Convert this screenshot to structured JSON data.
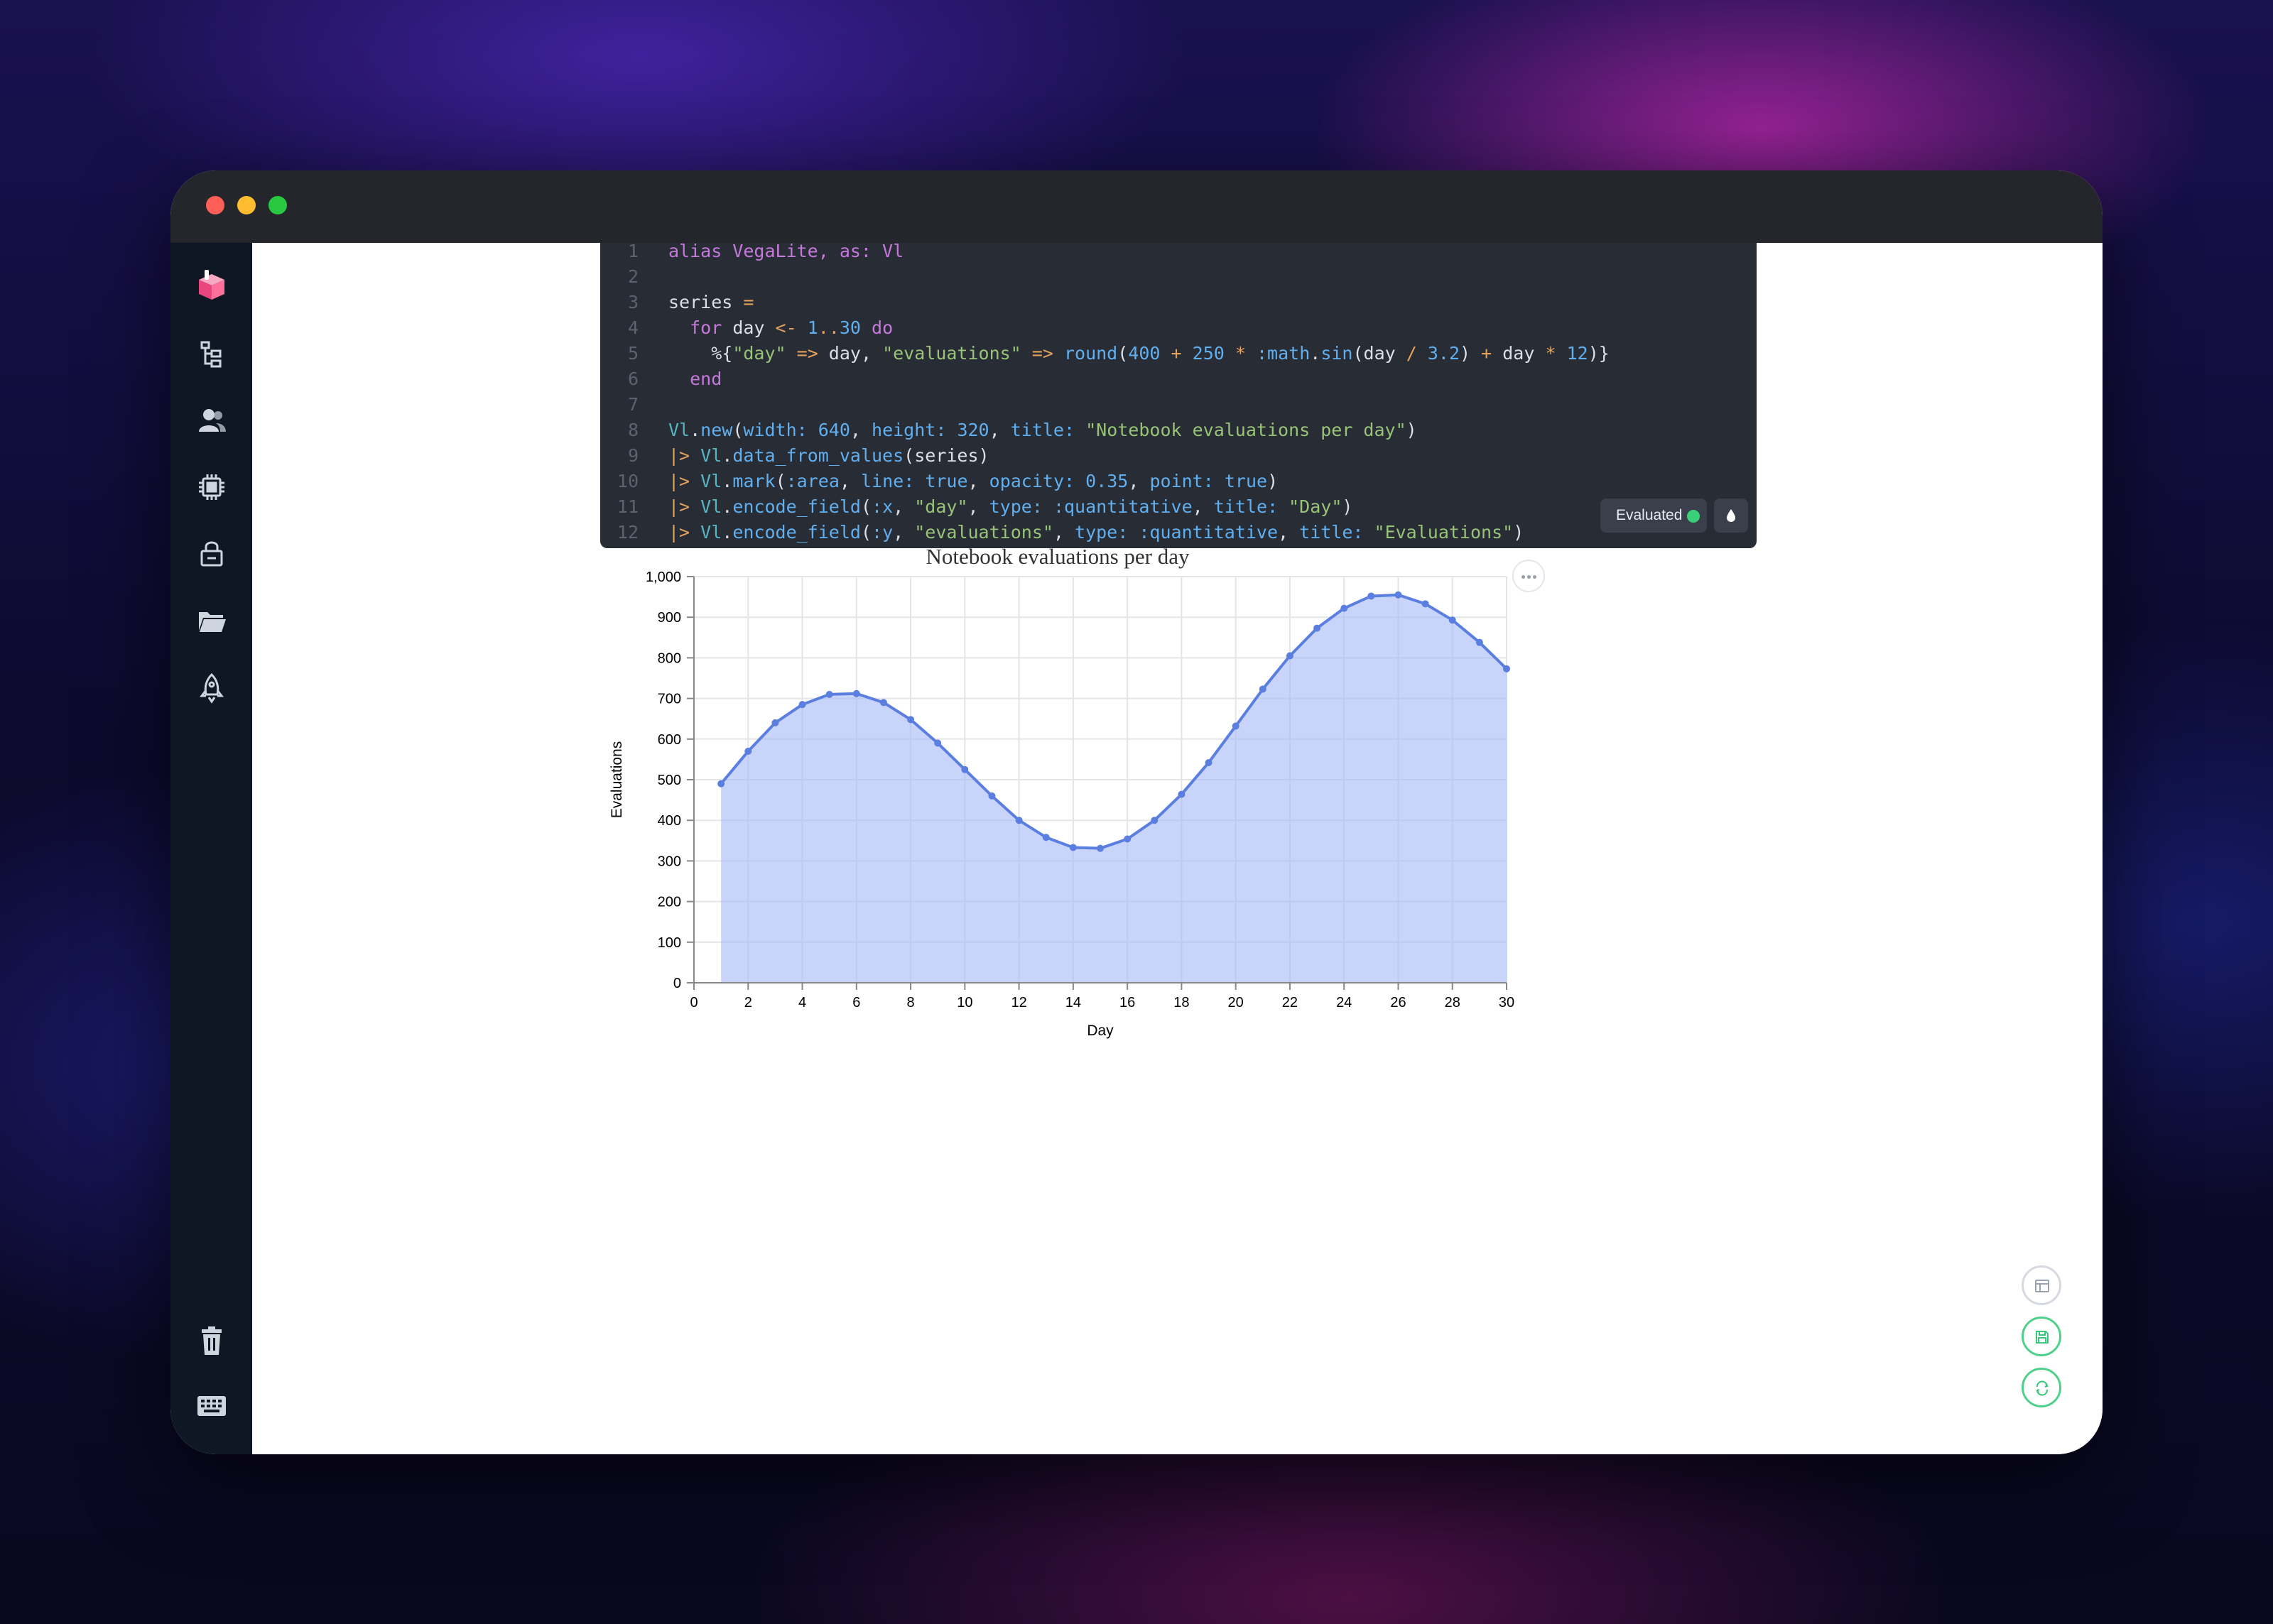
{
  "sidebar": {
    "icons": [
      "livebook-logo-icon",
      "explorer-icon",
      "users-icon",
      "runtime-chip-icon",
      "secrets-lock-icon",
      "files-folder-icon",
      "deploy-rocket-icon",
      "trash-icon",
      "keyboard-icon"
    ],
    "help_label": "?"
  },
  "code_cell": {
    "lines": [
      {
        "n": "1",
        "parts": [
          {
            "t": "alias VegaLite, as: Vl",
            "c": "kw"
          }
        ]
      },
      {
        "n": "2",
        "parts": []
      },
      {
        "n": "3",
        "parts": [
          {
            "t": "series ",
            "c": ""
          },
          {
            "t": "=",
            "c": "op"
          }
        ]
      },
      {
        "n": "4",
        "parts": [
          {
            "t": "  ",
            "c": ""
          },
          {
            "t": "for",
            "c": "kw"
          },
          {
            "t": " day ",
            "c": ""
          },
          {
            "t": "<-",
            "c": "op"
          },
          {
            "t": " ",
            "c": ""
          },
          {
            "t": "1",
            "c": "num"
          },
          {
            "t": "..",
            "c": "op"
          },
          {
            "t": "30",
            "c": "num"
          },
          {
            "t": " ",
            "c": ""
          },
          {
            "t": "do",
            "c": "kw"
          }
        ]
      },
      {
        "n": "5",
        "parts": [
          {
            "t": "    %{",
            "c": ""
          },
          {
            "t": "\"day\"",
            "c": "str"
          },
          {
            "t": " ",
            "c": ""
          },
          {
            "t": "=>",
            "c": "op"
          },
          {
            "t": " day, ",
            "c": ""
          },
          {
            "t": "\"evaluations\"",
            "c": "str"
          },
          {
            "t": " ",
            "c": ""
          },
          {
            "t": "=>",
            "c": "op"
          },
          {
            "t": " ",
            "c": ""
          },
          {
            "t": "round",
            "c": "fn"
          },
          {
            "t": "(",
            "c": ""
          },
          {
            "t": "400",
            "c": "num"
          },
          {
            "t": " ",
            "c": ""
          },
          {
            "t": "+",
            "c": "op"
          },
          {
            "t": " ",
            "c": ""
          },
          {
            "t": "250",
            "c": "num"
          },
          {
            "t": " ",
            "c": ""
          },
          {
            "t": "*",
            "c": "op"
          },
          {
            "t": " ",
            "c": ""
          },
          {
            "t": ":math",
            "c": "key"
          },
          {
            "t": ".",
            "c": ""
          },
          {
            "t": "sin",
            "c": "fn"
          },
          {
            "t": "(day ",
            "c": ""
          },
          {
            "t": "/",
            "c": "op"
          },
          {
            "t": " ",
            "c": ""
          },
          {
            "t": "3.2",
            "c": "num"
          },
          {
            "t": ") ",
            "c": ""
          },
          {
            "t": "+",
            "c": "op"
          },
          {
            "t": " day ",
            "c": ""
          },
          {
            "t": "*",
            "c": "op"
          },
          {
            "t": " ",
            "c": ""
          },
          {
            "t": "12",
            "c": "num"
          },
          {
            "t": ")}",
            "c": ""
          }
        ]
      },
      {
        "n": "6",
        "parts": [
          {
            "t": "  ",
            "c": ""
          },
          {
            "t": "end",
            "c": "kw"
          }
        ]
      },
      {
        "n": "7",
        "parts": []
      },
      {
        "n": "8",
        "parts": [
          {
            "t": "Vl",
            "c": "mod"
          },
          {
            "t": ".",
            "c": ""
          },
          {
            "t": "new",
            "c": "fn"
          },
          {
            "t": "(",
            "c": ""
          },
          {
            "t": "width:",
            "c": "key"
          },
          {
            "t": " ",
            "c": ""
          },
          {
            "t": "640",
            "c": "num"
          },
          {
            "t": ", ",
            "c": ""
          },
          {
            "t": "height:",
            "c": "key"
          },
          {
            "t": " ",
            "c": ""
          },
          {
            "t": "320",
            "c": "num"
          },
          {
            "t": ", ",
            "c": ""
          },
          {
            "t": "title:",
            "c": "key"
          },
          {
            "t": " ",
            "c": ""
          },
          {
            "t": "\"Notebook evaluations per day\"",
            "c": "str"
          },
          {
            "t": ")",
            "c": ""
          }
        ]
      },
      {
        "n": "9",
        "parts": [
          {
            "t": "|>",
            "c": "op"
          },
          {
            "t": " ",
            "c": ""
          },
          {
            "t": "Vl",
            "c": "mod"
          },
          {
            "t": ".",
            "c": ""
          },
          {
            "t": "data_from_values",
            "c": "fn"
          },
          {
            "t": "(series)",
            "c": ""
          }
        ]
      },
      {
        "n": "10",
        "parts": [
          {
            "t": "|>",
            "c": "op"
          },
          {
            "t": " ",
            "c": ""
          },
          {
            "t": "Vl",
            "c": "mod"
          },
          {
            "t": ".",
            "c": ""
          },
          {
            "t": "mark",
            "c": "fn"
          },
          {
            "t": "(",
            "c": ""
          },
          {
            "t": ":area",
            "c": "key"
          },
          {
            "t": ", ",
            "c": ""
          },
          {
            "t": "line:",
            "c": "key"
          },
          {
            "t": " ",
            "c": ""
          },
          {
            "t": "true",
            "c": "key"
          },
          {
            "t": ", ",
            "c": ""
          },
          {
            "t": "opacity:",
            "c": "key"
          },
          {
            "t": " ",
            "c": ""
          },
          {
            "t": "0.35",
            "c": "num"
          },
          {
            "t": ", ",
            "c": ""
          },
          {
            "t": "point:",
            "c": "key"
          },
          {
            "t": " ",
            "c": ""
          },
          {
            "t": "true",
            "c": "key"
          },
          {
            "t": ")",
            "c": ""
          }
        ]
      },
      {
        "n": "11",
        "parts": [
          {
            "t": "|>",
            "c": "op"
          },
          {
            "t": " ",
            "c": ""
          },
          {
            "t": "Vl",
            "c": "mod"
          },
          {
            "t": ".",
            "c": ""
          },
          {
            "t": "encode_field",
            "c": "fn"
          },
          {
            "t": "(",
            "c": ""
          },
          {
            "t": ":x",
            "c": "key"
          },
          {
            "t": ", ",
            "c": ""
          },
          {
            "t": "\"day\"",
            "c": "str"
          },
          {
            "t": ", ",
            "c": ""
          },
          {
            "t": "type:",
            "c": "key"
          },
          {
            "t": " ",
            "c": ""
          },
          {
            "t": ":quantitative",
            "c": "key"
          },
          {
            "t": ", ",
            "c": ""
          },
          {
            "t": "title:",
            "c": "key"
          },
          {
            "t": " ",
            "c": ""
          },
          {
            "t": "\"Day\"",
            "c": "str"
          },
          {
            "t": ")",
            "c": ""
          }
        ]
      },
      {
        "n": "12",
        "parts": [
          {
            "t": "|>",
            "c": "op"
          },
          {
            "t": " ",
            "c": ""
          },
          {
            "t": "Vl",
            "c": "mod"
          },
          {
            "t": ".",
            "c": ""
          },
          {
            "t": "encode_field",
            "c": "fn"
          },
          {
            "t": "(",
            "c": ""
          },
          {
            "t": ":y",
            "c": "key"
          },
          {
            "t": ", ",
            "c": ""
          },
          {
            "t": "\"evaluations\"",
            "c": "str"
          },
          {
            "t": ", ",
            "c": ""
          },
          {
            "t": "type:",
            "c": "key"
          },
          {
            "t": " ",
            "c": ""
          },
          {
            "t": ":quantitative",
            "c": "key"
          },
          {
            "t": ", ",
            "c": ""
          },
          {
            "t": "title:",
            "c": "key"
          },
          {
            "t": " ",
            "c": ""
          },
          {
            "t": "\"Evaluations\"",
            "c": "str"
          },
          {
            "t": ")",
            "c": ""
          }
        ]
      }
    ],
    "status_label": "Evaluated",
    "status_color": "#3ad07a"
  },
  "chart_data": {
    "type": "area",
    "title": "Notebook evaluations per day",
    "xlabel": "Day",
    "ylabel": "Evaluations",
    "xlim": [
      0,
      30
    ],
    "ylim": [
      0,
      1000
    ],
    "x_ticks": [
      "0",
      "2",
      "4",
      "6",
      "8",
      "10",
      "12",
      "14",
      "16",
      "18",
      "20",
      "22",
      "24",
      "26",
      "28",
      "30"
    ],
    "y_ticks": [
      "0",
      "100",
      "200",
      "300",
      "400",
      "500",
      "600",
      "700",
      "800",
      "900",
      "1,000"
    ],
    "grid": true,
    "line_color": "#5b7fe0",
    "fill_color": "#a4b8f6",
    "x": [
      1,
      2,
      3,
      4,
      5,
      6,
      7,
      8,
      9,
      10,
      11,
      12,
      13,
      14,
      15,
      16,
      17,
      18,
      19,
      20,
      21,
      22,
      23,
      24,
      25,
      26,
      27,
      28,
      29,
      30
    ],
    "y": [
      490,
      570,
      640,
      685,
      710,
      712,
      690,
      648,
      590,
      525,
      460,
      400,
      358,
      333,
      331,
      354,
      400,
      464,
      542,
      632,
      723,
      805,
      873,
      922,
      952,
      955,
      933,
      893,
      838,
      773
    ]
  },
  "floating_actions": [
    "sections-panel-icon",
    "save-icon",
    "reconnect-icon"
  ]
}
